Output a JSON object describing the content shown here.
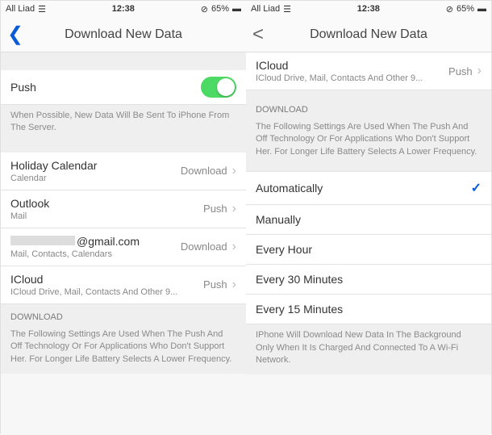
{
  "statusbar": {
    "carrier": "All Liad",
    "time": "12:38",
    "battery": "65%"
  },
  "left": {
    "header": {
      "title": "Download New Data"
    },
    "push": {
      "label": "Push",
      "footer": "When Possible, New Data Will Be Sent To iPhone From The Server."
    },
    "accounts": [
      {
        "title": "Holiday Calendar",
        "subtitle": "Calendar",
        "mode": "Download"
      },
      {
        "title": "Outlook",
        "subtitle": "Mail",
        "mode": "Push"
      },
      {
        "title": "@gmail.com",
        "subtitle": "Mail, Contacts, Calendars",
        "mode": "Download"
      },
      {
        "title": "ICloud",
        "subtitle": "ICloud Drive, Mail, Contacts And Other 9...",
        "mode": "Push"
      }
    ],
    "download": {
      "header": "DOWNLOAD",
      "footer": "The Following Settings Are Used When The Push And Off Technology Or For Applications Who Don't Support Her. For Longer Life Battery Selects A Lower Frequency."
    }
  },
  "right": {
    "header": {
      "title": "Download New Data"
    },
    "icloud": {
      "title": "ICloud",
      "subtitle": "ICloud Drive, Mail, Contacts And Other 9...",
      "mode": "Push"
    },
    "download": {
      "header": "DOWNLOAD",
      "info": "The Following Settings Are Used When The Push And Off Technology Or For Applications Who Don't Support Her. For Longer Life Battery Selects A Lower Frequency."
    },
    "options": [
      {
        "label": "Automatically",
        "selected": true
      },
      {
        "label": "Manually",
        "selected": false
      },
      {
        "label": "Every Hour",
        "selected": false
      },
      {
        "label": "Every 30 Minutes",
        "selected": false
      },
      {
        "label": "Every 15 Minutes",
        "selected": false
      }
    ],
    "footer": "IPhone Will Download New Data In The Background Only When It Is Charged And Connected To A Wi-Fi Network."
  }
}
